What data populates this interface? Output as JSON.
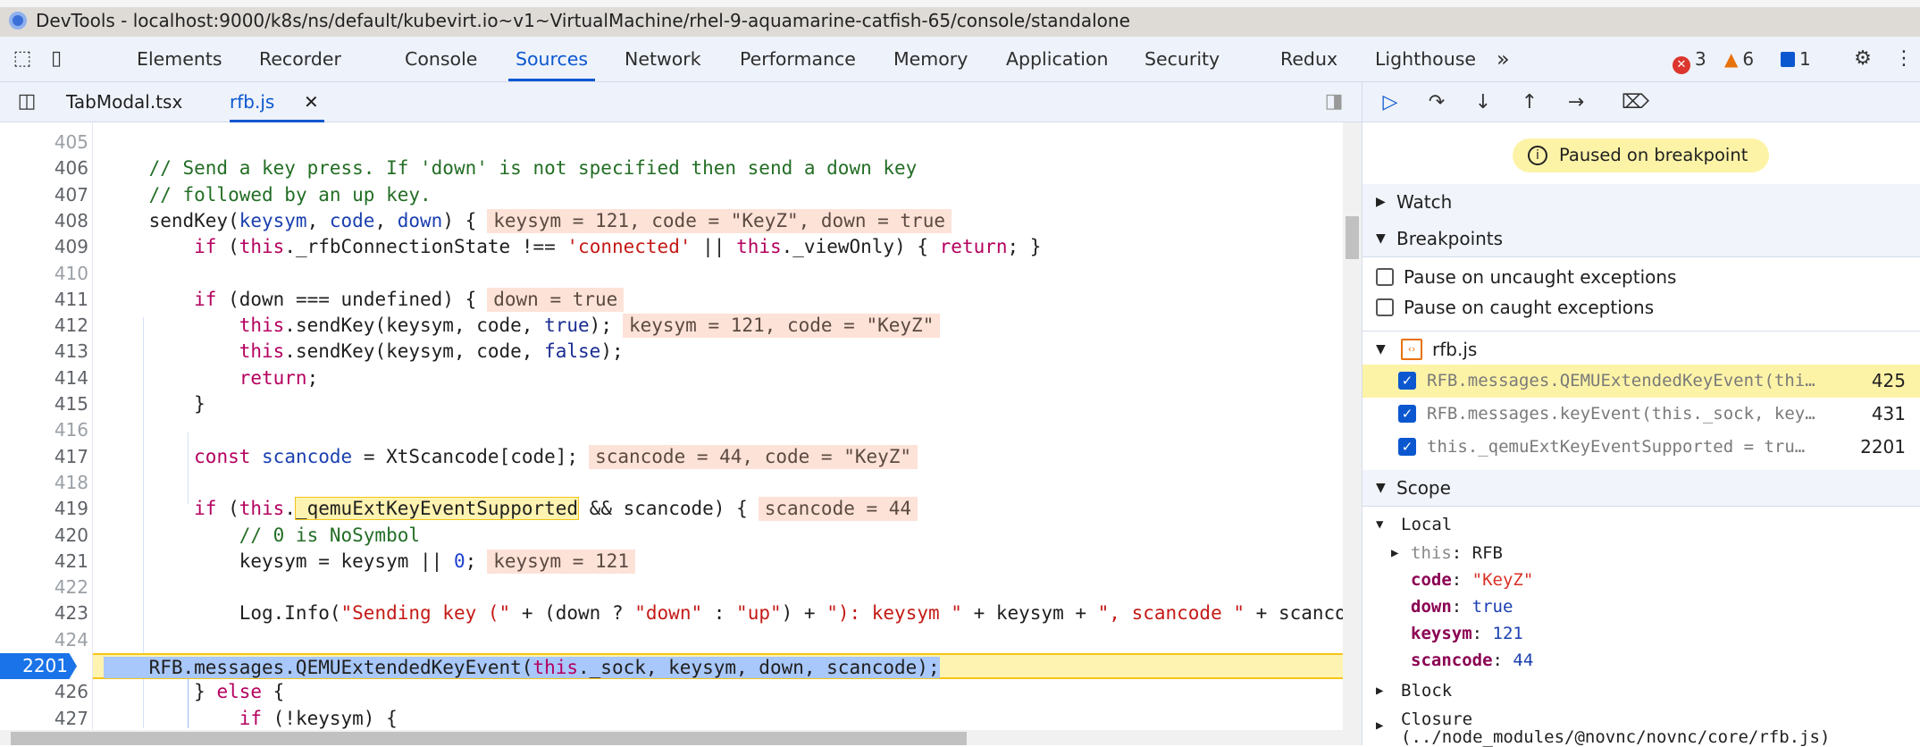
{
  "window": {
    "title": "DevTools - localhost:9000/k8s/ns/default/kubevirt.io~v1~VirtualMachine/rhel-9-aquamarine-catfish-65/console/standalone"
  },
  "tabs": [
    {
      "label": "Elements"
    },
    {
      "label": "Recorder"
    },
    {
      "label": "Console"
    },
    {
      "label": "Sources",
      "active": true
    },
    {
      "label": "Network"
    },
    {
      "label": "Performance"
    },
    {
      "label": "Memory"
    },
    {
      "label": "Application"
    },
    {
      "label": "Security"
    },
    {
      "label": "Redux"
    },
    {
      "label": "Lighthouse"
    }
  ],
  "more_tabs": "»",
  "counts": {
    "errors": "3",
    "warnings": "6",
    "messages": "1"
  },
  "files": {
    "tabs": [
      {
        "label": "TabModal.tsx"
      },
      {
        "label": "rfb.js",
        "active": true
      }
    ],
    "close": "✕"
  },
  "code": {
    "lines": [
      {
        "n": "405",
        "tokens": []
      },
      {
        "n": "406",
        "tokens": [
          {
            "t": "    "
          },
          {
            "t": "// Send a key press. If 'down' is not specified then send a down key",
            "c": "cm"
          }
        ]
      },
      {
        "n": "407",
        "tokens": [
          {
            "t": "    "
          },
          {
            "t": "// followed by an up key.",
            "c": "cm"
          }
        ]
      },
      {
        "n": "408",
        "tokens": [
          {
            "t": "    sendKey("
          },
          {
            "t": "keysym",
            "c": "def"
          },
          {
            "t": ", "
          },
          {
            "t": "code",
            "c": "def"
          },
          {
            "t": ", "
          },
          {
            "t": "down",
            "c": "def"
          },
          {
            "t": ") {"
          }
        ],
        "inline": "keysym = 121, code = \"KeyZ\", down = true"
      },
      {
        "n": "409",
        "tokens": [
          {
            "t": "        "
          },
          {
            "t": "if",
            "c": "kw"
          },
          {
            "t": " ("
          },
          {
            "t": "this",
            "c": "kw"
          },
          {
            "t": "._rfbConnectionState !== "
          },
          {
            "t": "'connected'",
            "c": "str"
          },
          {
            "t": " || "
          },
          {
            "t": "this",
            "c": "kw"
          },
          {
            "t": "._viewOnly) { "
          },
          {
            "t": "return",
            "c": "kw"
          },
          {
            "t": "; }"
          }
        ]
      },
      {
        "n": "410",
        "tokens": []
      },
      {
        "n": "411",
        "tokens": [
          {
            "t": "        "
          },
          {
            "t": "if",
            "c": "kw"
          },
          {
            "t": " (down === undefined) {"
          }
        ],
        "inline": "down = true"
      },
      {
        "n": "412",
        "tokens": [
          {
            "t": "            "
          },
          {
            "t": "this",
            "c": "kw"
          },
          {
            "t": ".sendKey(keysym, code, "
          },
          {
            "t": "true",
            "c": "lit"
          },
          {
            "t": ");"
          }
        ],
        "inline": "keysym = 121, code = \"KeyZ\""
      },
      {
        "n": "413",
        "tokens": [
          {
            "t": "            "
          },
          {
            "t": "this",
            "c": "kw"
          },
          {
            "t": ".sendKey(keysym, code, "
          },
          {
            "t": "false",
            "c": "lit"
          },
          {
            "t": ");"
          }
        ]
      },
      {
        "n": "414",
        "tokens": [
          {
            "t": "            "
          },
          {
            "t": "return",
            "c": "kw"
          },
          {
            "t": ";"
          }
        ]
      },
      {
        "n": "415",
        "tokens": [
          {
            "t": "        }"
          }
        ]
      },
      {
        "n": "416",
        "tokens": []
      },
      {
        "n": "417",
        "tokens": [
          {
            "t": "        "
          },
          {
            "t": "const",
            "c": "kw"
          },
          {
            "t": " "
          },
          {
            "t": "scancode",
            "c": "def"
          },
          {
            "t": " = XtScancode[code];"
          }
        ],
        "inline": "scancode = 44, code = \"KeyZ\""
      },
      {
        "n": "418",
        "tokens": []
      },
      {
        "n": "419",
        "tokens": [
          {
            "t": "        "
          },
          {
            "t": "if",
            "c": "kw"
          },
          {
            "t": " ("
          },
          {
            "t": "this",
            "c": "kw"
          },
          {
            "t": "."
          },
          {
            "t": "_qemuExtKeyEventSupported",
            "c": "hl"
          },
          {
            "t": " && scancode) {"
          }
        ],
        "inline": "scancode = 44"
      },
      {
        "n": "420",
        "tokens": [
          {
            "t": "            "
          },
          {
            "t": "// 0 is NoSymbol",
            "c": "cm"
          }
        ]
      },
      {
        "n": "421",
        "tokens": [
          {
            "t": "            keysym = keysym || "
          },
          {
            "t": "0",
            "c": "num"
          },
          {
            "t": ";"
          }
        ],
        "inline": "keysym = 121"
      },
      {
        "n": "422",
        "tokens": []
      },
      {
        "n": "423",
        "tokens": [
          {
            "t": "            Log.Info("
          },
          {
            "t": "\"Sending key (\"",
            "c": "str"
          },
          {
            "t": " + (down ? "
          },
          {
            "t": "\"down\"",
            "c": "str"
          },
          {
            "t": " : "
          },
          {
            "t": "\"up\"",
            "c": "str"
          },
          {
            "t": ") + "
          },
          {
            "t": "\"): keysym \"",
            "c": "str"
          },
          {
            "t": " + keysym + "
          },
          {
            "t": "\", scancode \"",
            "c": "str"
          },
          {
            "t": " + scancode"
          }
        ]
      },
      {
        "n": "424",
        "tokens": []
      },
      {
        "n": "2201",
        "exec": true,
        "tokens": [
          {
            "t": "    RFB.messages.QEMUExtendedKeyEvent("
          },
          {
            "t": "this",
            "c": "kw"
          },
          {
            "t": "._sock, keysym, down, scancode);"
          }
        ]
      },
      {
        "n": "426",
        "tokens": [
          {
            "t": "        } "
          },
          {
            "t": "else",
            "c": "kw"
          },
          {
            "t": " {"
          }
        ]
      },
      {
        "n": "427",
        "tokens": [
          {
            "t": "            "
          },
          {
            "t": "if",
            "c": "kw"
          },
          {
            "t": " (!keysym) {"
          }
        ]
      }
    ]
  },
  "debugger": {
    "paused": "Paused on breakpoint",
    "watch": "Watch",
    "breakpoints": "Breakpoints",
    "pause_uncaught": "Pause on uncaught exceptions",
    "pause_caught": "Pause on caught exceptions",
    "bp_file": "rfb.js",
    "bp_list": [
      {
        "text": "RFB.messages.QEMUExtendedKeyEvent(thi…",
        "line": "425",
        "checked": true,
        "active": true
      },
      {
        "text": "RFB.messages.keyEvent(this._sock, key…",
        "line": "431",
        "checked": true
      },
      {
        "text": "this._qemuExtKeyEventSupported = tru…",
        "line": "2201",
        "checked": true
      }
    ],
    "scope": "Scope",
    "local": "Local",
    "vars": [
      {
        "name": "this",
        "value": "RFB",
        "type": "obj"
      },
      {
        "name": "code",
        "value": "\"KeyZ\"",
        "type": "str"
      },
      {
        "name": "down",
        "value": "true",
        "type": "lit"
      },
      {
        "name": "keysym",
        "value": "121",
        "type": "num"
      },
      {
        "name": "scancode",
        "value": "44",
        "type": "num"
      }
    ],
    "block": "Block",
    "closure": "Closure",
    "closure_path": "(../node_modules/@novnc/novnc/core/rfb.js)"
  },
  "colors": {
    "accent": "#0b57d0",
    "error": "#dc362e",
    "warning": "#e8710a",
    "exec_line": "#fef3b0",
    "inline_value": "#fde2d8"
  }
}
